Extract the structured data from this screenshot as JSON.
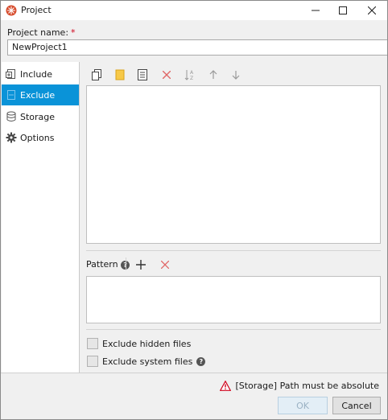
{
  "window": {
    "title": "Project",
    "controls": [
      "minimize-icon",
      "maximize-icon",
      "close-icon"
    ]
  },
  "project_name": {
    "label": "Project name:",
    "required_mark": "*",
    "value": "NewProject1"
  },
  "nav": {
    "items": [
      {
        "label": "Include",
        "icon": "include-icon",
        "active": false
      },
      {
        "label": "Exclude",
        "icon": "exclude-icon",
        "active": true
      },
      {
        "label": "Storage",
        "icon": "database-icon",
        "active": false
      },
      {
        "label": "Options",
        "icon": "gear-icon",
        "active": false
      }
    ]
  },
  "toolbar": {
    "icons": [
      "new-file-icon",
      "folder-icon",
      "text-file-icon",
      "delete-icon",
      "sort-az-icon",
      "move-up-icon",
      "move-down-icon"
    ]
  },
  "pattern": {
    "label": "Pattern",
    "help": "?",
    "icons": [
      "add-icon",
      "remove-icon"
    ]
  },
  "options": {
    "exclude_hidden": {
      "label": "Exclude hidden files",
      "checked": false
    },
    "exclude_system": {
      "label": "Exclude system files",
      "checked": false,
      "help": "?"
    }
  },
  "footer": {
    "warning": "[Storage] Path must be absolute",
    "ok_label": "OK",
    "cancel_label": "Cancel"
  },
  "colors": {
    "accent": "#0a93d8",
    "warning": "#d0021b",
    "delete": "#e06666"
  }
}
